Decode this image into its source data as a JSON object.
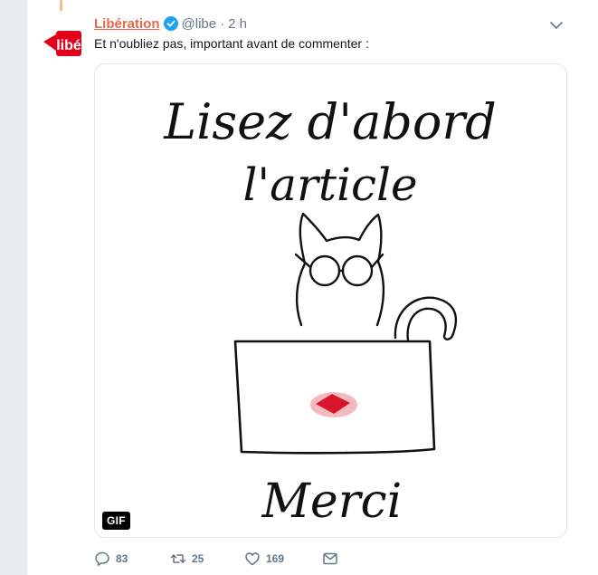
{
  "tweet": {
    "author_name": "Libération",
    "handle": "@libe",
    "separator": "·",
    "time": "2 h",
    "text": "Et n'oubliez pas, important avant de commenter :",
    "avatar_text": "libé",
    "media": {
      "badge": "GIF",
      "handwriting_line1": "Lisez d'abord",
      "handwriting_line2": "l'article",
      "handwriting_line3": "Merci"
    },
    "actions": {
      "replies": "83",
      "retweets": "25",
      "likes": "169"
    }
  },
  "colors": {
    "accent_name": "#e8664a",
    "verified": "#1da1f2",
    "muted": "#657786",
    "thread_line": "#f6b98a",
    "avatar_red": "#e2001a"
  },
  "icons": {
    "verified": "verified-badge-icon",
    "caret": "chevron-down-icon",
    "reply": "reply-icon",
    "retweet": "retweet-icon",
    "like": "heart-icon",
    "dm": "envelope-icon"
  }
}
